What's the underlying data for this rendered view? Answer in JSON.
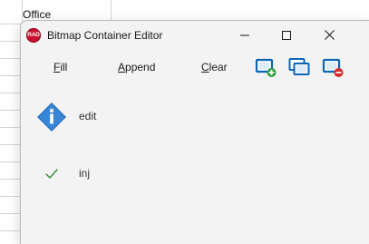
{
  "background_sheet": {
    "cell_text": "Office"
  },
  "window": {
    "title": "Bitmap Container Editor",
    "app_icon_text": "RAD",
    "controls": [
      "minimize",
      "maximize",
      "close"
    ]
  },
  "toolbar": {
    "fill_label": "Fill",
    "fill_accel": "F",
    "fill_rest": "ill",
    "append_label": "Append",
    "append_accel": "A",
    "append_rest": "ppend",
    "clear_label": "Clear",
    "clear_accel": "C",
    "clear_rest": "lear",
    "icons": [
      "add-bitmap-icon",
      "duplicate-bitmap-icon",
      "remove-bitmap-icon"
    ],
    "accent_color": "#0a66b8"
  },
  "items": [
    {
      "label": "edit",
      "icon": "info-diamond-icon"
    },
    {
      "label": "inj",
      "icon": "checkmark-icon"
    }
  ]
}
